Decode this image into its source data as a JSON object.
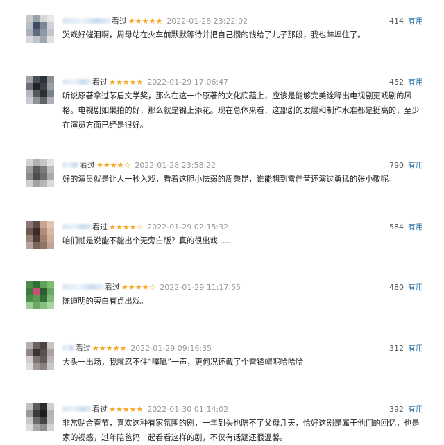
{
  "reviews": [
    {
      "status": "看过",
      "stars": "★★★★★",
      "time": "2022-01-28 23:22:02",
      "votes": "414",
      "useful_label": "有用",
      "text": "哭戏好催泪啊，周母站在火车前默默等待并把自己攒的钱给了儿子那段，我也蚌埠住了。",
      "name_width": 70,
      "avatar_colors": [
        "#c8c8c8",
        "#9aa3ad",
        "#d6d6d6",
        "#e8e8e8",
        "#b8bec7",
        "#3f4d63",
        "#7c8898",
        "#cfd2d6",
        "#a9b1bb",
        "#5e6b7c",
        "#8f99a6",
        "#c3c7cc",
        "#d9d9d9",
        "#bcc3cb",
        "#9ea7b2",
        "#e2e2e2"
      ]
    },
    {
      "status": "看过",
      "stars": "★★★★★",
      "time": "2022-01-29 17:06:47",
      "votes": "452",
      "useful_label": "有用",
      "text": "听说原著拿过茅盾文学奖，那么在这一个原著的文化底蕴上，应该是能够完美诠释出电视剧更戏剧的风格。电视剧如果拍的好，那么就是锦上添花。现在总体来看，这部剧的发展和制作水准都是挺高的，至少在演员方面已经是很好。",
      "name_width": 42,
      "avatar_colors": [
        "#a0a4a8",
        "#4a4e52",
        "#2f3438",
        "#8a8f94",
        "#6b7075",
        "#1f2428",
        "#3b4146",
        "#9a9fa4",
        "#b5b9bd",
        "#555a5f",
        "#2a2f33",
        "#7d8287",
        "#c9ccd0",
        "#8c9196",
        "#60656a",
        "#aeb2b6"
      ]
    },
    {
      "status": "看过",
      "stars": "★★★★☆",
      "time": "2022-01-28 23:58:22",
      "votes": "790",
      "useful_label": "有用",
      "text": "好的演员就是让人一秒入戏，看着这胆小怯弱的周秉昆，谁能想到雷佳音还演过勇猛的张小敬呢。",
      "name_width": 24,
      "avatar_colors": [
        "#d2d2d2",
        "#b0b0b0",
        "#c6c6c6",
        "#e1e1e1",
        "#9c9c9c",
        "#5a5a5a",
        "#7a7a7a",
        "#bdbdbd",
        "#8b8b8b",
        "#4d4d4d",
        "#6e6e6e",
        "#aaaaaa",
        "#cfcfcf",
        "#a3a3a3",
        "#b8b8b8",
        "#dadada"
      ]
    },
    {
      "status": "看过",
      "stars": "★★★★☆",
      "time": "2022-01-29 02:15:32",
      "votes": "584",
      "useful_label": "有用",
      "text": "咱们就是说能不能出个无旁白版？真的很出戏.....",
      "name_width": 42,
      "avatar_colors": [
        "#8a7a74",
        "#5d4b45",
        "#c9a393",
        "#e3c5b4",
        "#6f5a52",
        "#3a2c27",
        "#b48c7a",
        "#d9b8a6",
        "#9a8278",
        "#4e3c35",
        "#a57f6e",
        "#cfae9c",
        "#b7a49c",
        "#7a655c",
        "#8e7469",
        "#c2a596"
      ]
    },
    {
      "status": "看过",
      "stars": "★★★★☆",
      "time": "2022-01-29 11:17:55",
      "votes": "480",
      "useful_label": "有用",
      "text": "陈道明的旁白有点出戏。",
      "name_width": 60,
      "avatar_colors": [
        "#4f8a4a",
        "#2f6e34",
        "#5ea35a",
        "#7bbf73",
        "#3c7a3f",
        "#c94f7a",
        "#2d5e30",
        "#6aa865",
        "#4a8d48",
        "#5b9a56",
        "#376f3a",
        "#82b97b",
        "#9ccf93",
        "#6fa96a",
        "#86c07e",
        "#a9d6a0"
      ]
    },
    {
      "status": "看过",
      "stars": "★★★★★",
      "time": "2022-01-29 09:16:35",
      "votes": "312",
      "useful_label": "有用",
      "text": "大头一出场，我就忍不住“噗呲”一声，更何况还戴了个雷锋帽呢哈哈哈",
      "name_width": 18,
      "avatar_colors": [
        "#b4b0ae",
        "#6b6361",
        "#4d4542",
        "#c8c4c2",
        "#8f8785",
        "#3b3331",
        "#59504d",
        "#a9a3a1",
        "#d1cdcb",
        "#7d7572",
        "#625a57",
        "#bcb7b5",
        "#e0dcda",
        "#9d9694",
        "#8a8280",
        "#cbc7c5"
      ]
    },
    {
      "status": "看过",
      "stars": "★★★★★",
      "time": "2022-01-30 01:14:02",
      "votes": "392",
      "useful_label": "有用",
      "text": "非常贴合春节，喜欢这种有家氛围的剧，一年到头也陪不了父母几天，恰好这剧是属于他们的回忆，也是家的视感，过年陪爸妈一起看看这样的剧，不仅有话题还很温馨。",
      "name_width": 42,
      "avatar_colors": [
        "#c0c0c0",
        "#5a5a5a",
        "#2b2b2b",
        "#d0d0d0",
        "#9a9a9a",
        "#3a3a3a",
        "#1c1c1c",
        "#b4b4b4",
        "#c8c8c8",
        "#6a6a6a",
        "#444444",
        "#bababa",
        "#dddddd",
        "#a8a8a8",
        "#8e8e8e",
        "#d4d4d4"
      ]
    }
  ]
}
